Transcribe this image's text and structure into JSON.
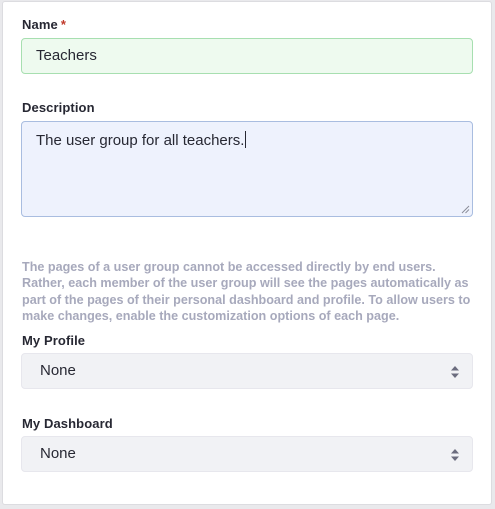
{
  "form": {
    "name": {
      "label": "Name",
      "required_mark": "*",
      "value": "Teachers"
    },
    "description": {
      "label": "Description",
      "value": "The user group for all teachers."
    },
    "help_text": "The pages of a user group cannot be accessed directly by end users. Rather, each member of the user group will see the pages automatically as part of the pages of their personal dashboard and profile. To allow users to make changes, enable the customization options of each page.",
    "my_profile": {
      "label": "My Profile",
      "selected": "None"
    },
    "my_dashboard": {
      "label": "My Dashboard",
      "selected": "None"
    }
  },
  "colors": {
    "name_field_bg": "#eefaef",
    "name_field_border": "#a7dfb0",
    "description_field_bg": "#eef2fd",
    "description_field_border": "#a9bde0",
    "required_mark": "#c0392b",
    "help_text": "#a7a9bc"
  },
  "icons": {
    "select_arrows": "chevron-up-down-icon",
    "resize": "resize-grip-icon"
  }
}
